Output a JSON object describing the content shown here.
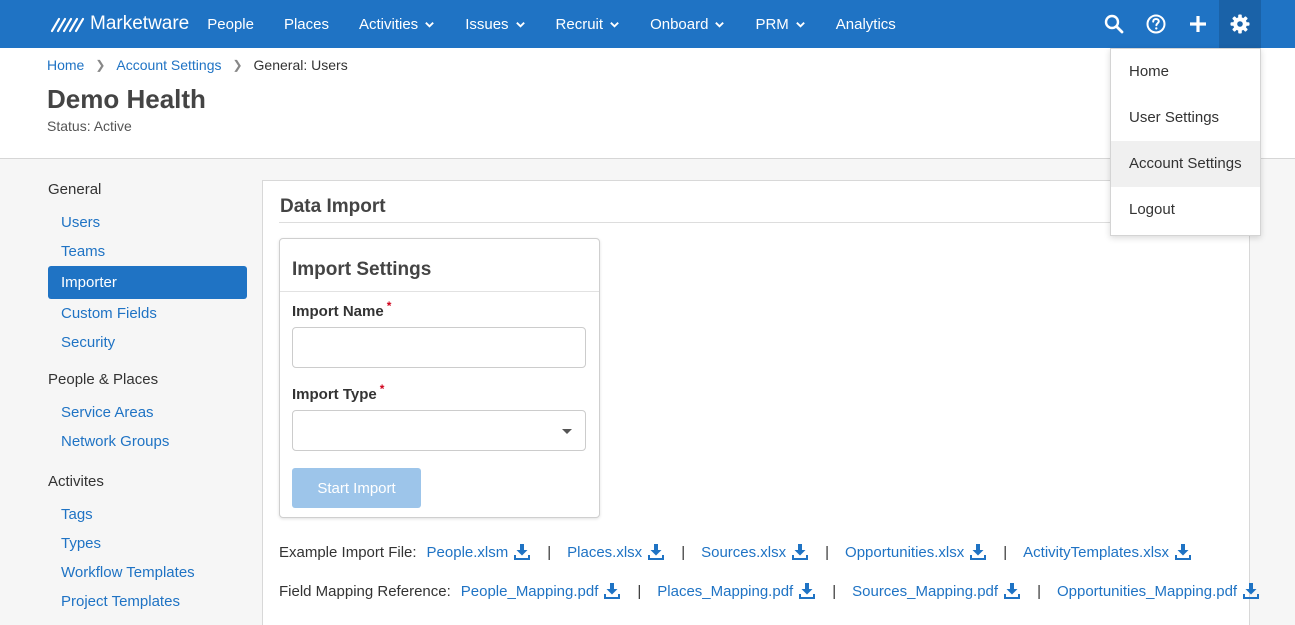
{
  "brand": {
    "name": "Marketware",
    "color": "#1f73c4"
  },
  "nav": {
    "items": [
      {
        "label": "People",
        "has_dropdown": false
      },
      {
        "label": "Places",
        "has_dropdown": false
      },
      {
        "label": "Activities",
        "has_dropdown": true
      },
      {
        "label": "Issues",
        "has_dropdown": true
      },
      {
        "label": "Recruit",
        "has_dropdown": true
      },
      {
        "label": "Onboard",
        "has_dropdown": true
      },
      {
        "label": "PRM",
        "has_dropdown": true
      },
      {
        "label": "Analytics",
        "has_dropdown": false
      }
    ],
    "icons": [
      "search-icon",
      "help-icon",
      "plus-icon",
      "gear-icon"
    ]
  },
  "breadcrumb": {
    "home": "Home",
    "account_settings": "Account Settings",
    "current": "General: Users"
  },
  "header": {
    "title": "Demo Health",
    "status": "Status: Active"
  },
  "sidebar": {
    "groups": [
      {
        "label": "General",
        "items": [
          "Users",
          "Teams",
          "Importer",
          "Custom Fields",
          "Security"
        ]
      },
      {
        "label": "People & Places",
        "items": [
          "Service Areas",
          "Network Groups"
        ]
      },
      {
        "label": "Activites",
        "items": [
          "Tags",
          "Types",
          "Workflow Templates",
          "Project Templates"
        ]
      }
    ],
    "active_item": "Importer"
  },
  "main": {
    "title": "Data Import",
    "card": {
      "title": "Import Settings",
      "import_name_label": "Import Name",
      "import_name_value": "",
      "import_type_label": "Import Type",
      "import_type_value": "",
      "required_mark": "*",
      "start_button": "Start Import"
    },
    "example_files": {
      "label": "Example Import File:",
      "files": [
        "People.xlsm",
        "Places.xlsx",
        "Sources.xlsx",
        "Opportunities.xlsx",
        "ActivityTemplates.xlsx"
      ]
    },
    "mapping_files": {
      "label": "Field Mapping Reference:",
      "files": [
        "People_Mapping.pdf",
        "Places_Mapping.pdf",
        "Sources_Mapping.pdf",
        "Opportunities_Mapping.pdf"
      ]
    },
    "separator": "|"
  },
  "settings_menu": {
    "items": [
      "Home",
      "User Settings",
      "Account Settings",
      "Logout"
    ],
    "highlighted": "Account Settings"
  }
}
